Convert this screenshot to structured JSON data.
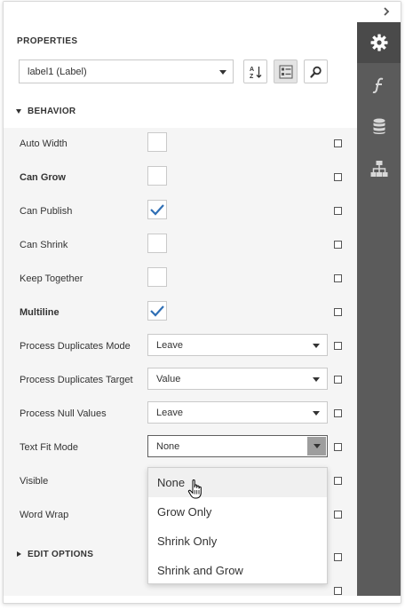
{
  "panel": {
    "title": "PROPERTIES",
    "object_select": {
      "value": "label1 (Label)"
    },
    "toolbar": [
      {
        "name": "sort-alphabetically",
        "icon": "sort-az-icon"
      },
      {
        "name": "categorize",
        "icon": "categorized-icon",
        "active": true
      },
      {
        "name": "search",
        "icon": "search-icon"
      }
    ]
  },
  "sidebar": {
    "tabs": [
      {
        "name": "properties",
        "icon": "gear-icon",
        "active": true
      },
      {
        "name": "expressions",
        "icon": "function-icon",
        "active": false
      },
      {
        "name": "data-source",
        "icon": "database-icon",
        "active": false
      },
      {
        "name": "report-explorer",
        "icon": "hierarchy-icon",
        "active": false
      }
    ]
  },
  "sections": {
    "behavior": "BEHAVIOR",
    "edit_options": "EDIT OPTIONS"
  },
  "properties": [
    {
      "label": "Auto Width",
      "bold": false,
      "type": "checkbox",
      "checked": false
    },
    {
      "label": "Can Grow",
      "bold": true,
      "type": "checkbox",
      "checked": false
    },
    {
      "label": "Can Publish",
      "bold": false,
      "type": "checkbox",
      "checked": true
    },
    {
      "label": "Can Shrink",
      "bold": false,
      "type": "checkbox",
      "checked": false
    },
    {
      "label": "Keep Together",
      "bold": false,
      "type": "checkbox",
      "checked": false
    },
    {
      "label": "Multiline",
      "bold": true,
      "type": "checkbox",
      "checked": true
    },
    {
      "label": "Process Duplicates Mode",
      "bold": false,
      "type": "dropdown",
      "value": "Leave"
    },
    {
      "label": "Process Duplicates Target",
      "bold": false,
      "type": "dropdown",
      "value": "Value"
    },
    {
      "label": "Process Null Values",
      "bold": false,
      "type": "dropdown",
      "value": "Leave"
    },
    {
      "label": "Text Fit Mode",
      "bold": false,
      "type": "dropdown",
      "value": "None",
      "open": true
    },
    {
      "label": "Visible",
      "bold": false,
      "type": "hidden"
    },
    {
      "label": "Word Wrap",
      "bold": false,
      "type": "hidden"
    }
  ],
  "dropdown_popup": {
    "options": [
      "None",
      "Grow Only",
      "Shrink Only",
      "Shrink and Grow"
    ],
    "hovered": "None"
  },
  "colors": {
    "sidebar": "#5b5b5b",
    "sidebar_active": "#4a4a4a",
    "check": "#2f6fb5",
    "props_bg": "#f5f5f5"
  }
}
